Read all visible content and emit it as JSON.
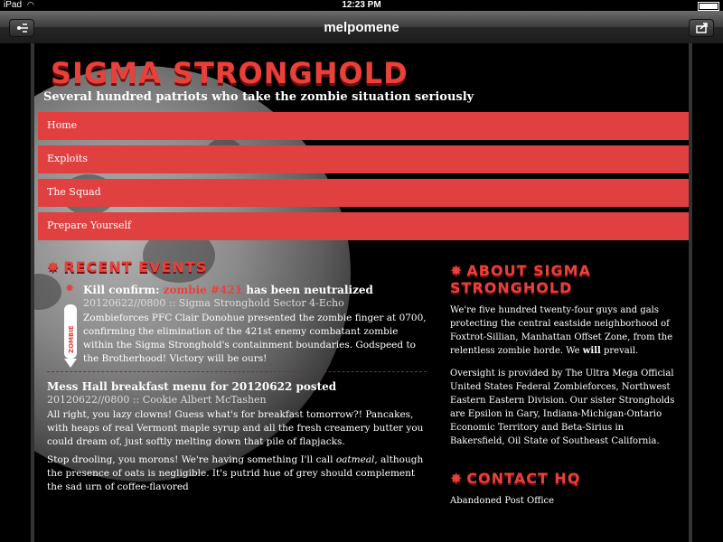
{
  "status": {
    "carrier": "iPad",
    "time": "12:23 PM"
  },
  "toolbar": {
    "title": "melpomene",
    "left_icon": "bookmarks-icon",
    "right_icon": "share-icon"
  },
  "site": {
    "title": "SIGMA STRONGHOLD",
    "tagline": "Several hundred patriots who take the zombie situation seriously"
  },
  "nav": [
    "Home",
    "Exploits",
    "The Squad",
    "Prepare Yourself"
  ],
  "recent": {
    "heading": "RECENT EVENTS",
    "posts": [
      {
        "title_pre": "Kill confirm: ",
        "title_hl": "zombie #421",
        "title_post": " has been neutralized",
        "meta": "20120622//0800 :: Sigma Stronghold Sector 4-Echo",
        "badge": "ZOMBIE",
        "body": "Zombieforces PFC Clair Donohue presented the zombie finger at 0700, confirming the elimination of the 421st enemy combatant zombie within the Sigma Stronghold's containment boundaries. Godspeed to the Brotherhood! Victory will be ours!"
      },
      {
        "title": "Mess Hall breakfast menu for 20120622 posted",
        "meta": "20120622//0800 :: Cookie Albert McTashen",
        "body1": "All right, you lazy clowns! Guess what's for breakfast tomorrow?! Pancakes, with heaps of real Vermont maple syrup and all the fresh creamery butter you could dream of, just softly melting down that pile of flapjacks.",
        "body2_pre": "Stop drooling, you morons! We're having something I'll call ",
        "body2_em": "oatmeal",
        "body2_post": ", although the presence of oats is negligible. It's putrid hue of grey should complement the sad urn of coffee-flavored"
      }
    ]
  },
  "about": {
    "heading": "ABOUT SIGMA STRONGHOLD",
    "p1_pre": "We're five hundred twenty-four guys and gals protecting the central eastside neighborhood of Foxtrot-Sillian, Manhattan Offset Zone, from the relentless zombie horde. We ",
    "p1_strong": "will",
    "p1_post": " prevail.",
    "p2": "Oversight is provided by The Ultra Mega Official United States Federal Zombieforces, Northwest Eastern Eastern Division. Our sister Strongholds are Epsilon in Gary, Indiana-Michigan-Ontario Economic Territory and Beta-Sirius in Bakersfield, Oil State of Southeast California."
  },
  "contact": {
    "heading": "CONTACT HQ",
    "line1": "Abandoned Post Office"
  },
  "colors": {
    "accent": "#e0403f",
    "background": "#000000"
  }
}
